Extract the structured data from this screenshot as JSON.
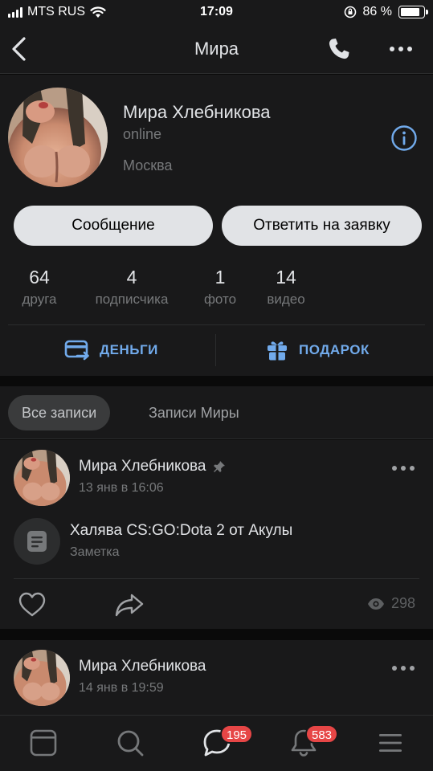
{
  "status_bar": {
    "carrier": "MTS RUS",
    "time": "17:09",
    "battery": "86 %",
    "battery_level": 0.86
  },
  "nav": {
    "title": "Мира",
    "back_icon": "chevron-left-icon",
    "call_icon": "phone-icon",
    "more_icon": "more-horizontal-icon"
  },
  "profile": {
    "name": "Мира Хлебникова",
    "status": "online",
    "city": "Москва",
    "info_icon": "info-icon",
    "message_button": "Сообщение",
    "reply_button": "Ответить на заявку",
    "stats": [
      {
        "num": "64",
        "label": "друга"
      },
      {
        "num": "4",
        "label": "подписчика"
      },
      {
        "num": "1",
        "label": "фото"
      },
      {
        "num": "14",
        "label": "видео"
      }
    ],
    "money_label": "ДЕНЬГИ",
    "gift_label": "ПОДАРОК"
  },
  "wall_tabs": {
    "all": "Все записи",
    "own": "Записи Миры"
  },
  "posts": [
    {
      "author": "Мира Хлебникова",
      "pinned": true,
      "time": "13 янв в 16:06",
      "note_title": "Халява CS:GO:Dota 2 от Акулы",
      "note_type": "Заметка",
      "views": "298"
    },
    {
      "author": "Мира Хлебникова",
      "time": "14 янв в 19:59"
    }
  ],
  "tabbar": {
    "messages_badge": "195",
    "notifications_badge": "583"
  },
  "colors": {
    "accent": "#71aaeb",
    "background": "#0a0a0a",
    "card": "#19191a",
    "badge": "#e64646"
  }
}
